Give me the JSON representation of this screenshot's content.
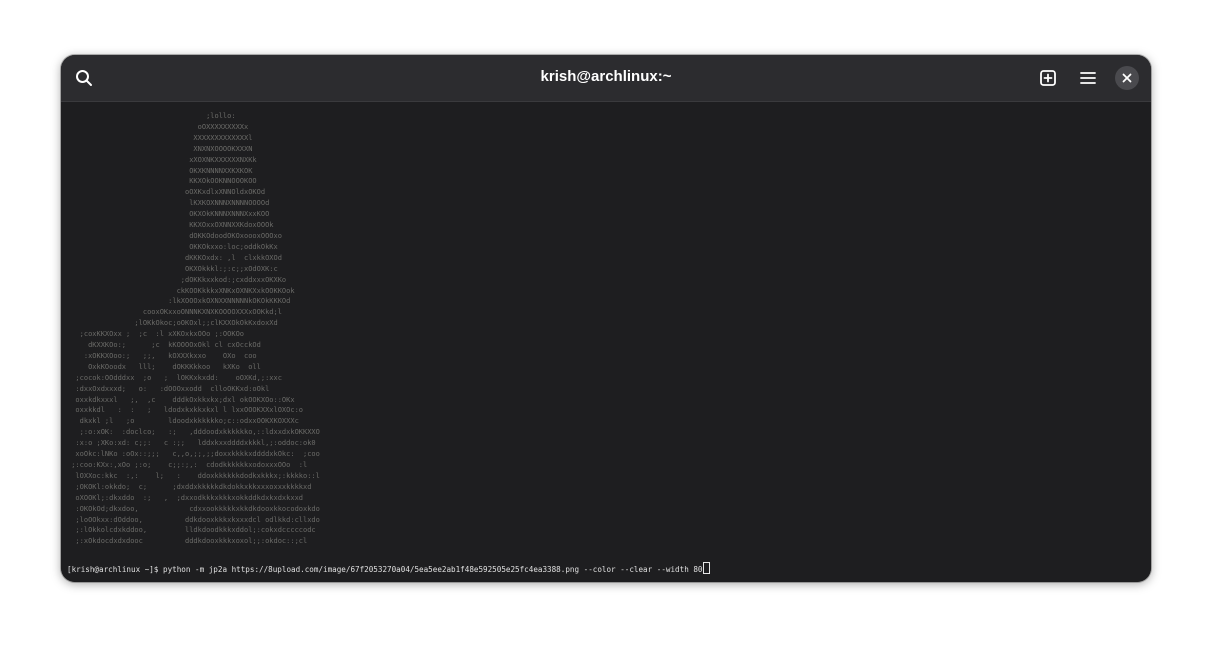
{
  "window": {
    "title": "krish@archlinux:~"
  },
  "icons": {
    "search": "search-icon",
    "new_tab": "new-tab-icon",
    "menu": "hamburger-menu-icon",
    "close": "close-icon"
  },
  "terminal": {
    "ascii_art": [
      "                                 ;lollo:",
      "                               oOXXXXXXXXXx",
      "                              XXXXXXXXXXXXXl",
      "                              XNXNXOOOOKXXXN",
      "                             xXOXNKXXXXXXNXKk",
      "                             OKXKNNNNXXKXKOK",
      "                             KKXOkOOKNNOOOKOO",
      "                            oOXKxdlxXNNOldxOKOd",
      "                             lKXKOXNNNXNNNNOOOOd",
      "                             OKXOkKNNNXNNNXxxKOO",
      "                             KKXOxxOXNNXXKdoxOOOk",
      "                             dOKKOdoodOKOxoooxOOOxo",
      "                             OKKOkxxo:loc;oddkOkKx",
      "                            dKKKOxdx: ,l  clxkkOXOd",
      "                            OKXOkkkl:;:c;;xOdOXK:c",
      "                           ;dOKKkxxkod:;cxddxxxOKXKo",
      "                          ckKOOKkkkxXNKxOXNKXxkOOKKOok",
      "                        :lkXOOOxkOXNXXNNNNNkOKOkKKKOd",
      "                  cooxOKxxoONNNKXNXKOOOOXXXxOOKkd;l",
      "                ;lOKkOkoc;oOKOxl;;clKXXOkOkKxdoxXd",
      "   ;coxKKXOxx ;  ;c  :l xXKOxkxOOo ;:OOKOo",
      "     dKXXKOo:;      ;c  kKOOOOxOkl cl cxOcckOd",
      "    :xOKKXOoo:;   ;;,   kOXXXkxxo    OXo  coo",
      "     OxkKOoodx   lll;    dOKKKkkoo   kXKo  oll",
      "  ;cocok:OOdddxx  ;o   ;  lOKKxkxdd:    oOXKd,;:xxc",
      "  :dxxOxdxxxd;   o:   :dOOOxxodd  clloOKKxd:oOkl",
      "  oxxkdkxxxl   ;,  ,c    dddkOxkkxkx;dxl okOOKXOo::OKx",
      "  oxxkkdl   :  :   ;   ldodxkxkkxkxl l lxxOOOKXXxlOXOc:o",
      "   dkxkl ;l   ;o        ldoodxkkkkkko;c::odxxOOKXKOXXXc",
      "   ;:o:xOK:  :doclco;   :;   ,dddoodxkkkkkko,::ldxxdxkOKKXXO",
      "  :x:o ;XKo:xd: c;;:   c :;;   lddxkxxddddxkkkl,;:oddoc:ok0",
      "  xoOkc:lNKo :oOx::;;;   c,,o,;;,;;doxxkkkkxddddxkOkc:  ;coo",
      " ;:coo:KXx:,xOo ;:o;    c;;:;,:  cdodkkkkkkxodoxxxOOo  :l",
      "  lOXXoc:kkc  :,:    l;   :    ddoxkkkkkkdodkxkkkx;:kkkko::l",
      "  ;OKOKl:okkdo;  c;      ;dxddxkkkkkdkdokkxkkxxxoxxxkkkkxd",
      "  oXOOKl;:dkxddo  :;   ,  ;dxxodkkkxkkkxokkddkdxkxdxkxxd",
      "  :OKOkOd;dkxdoo,            cdxxookkkkkxkkdkdooxkkocodoxkdo",
      "  ;loOOkxx:dOddoo,          ddkdooxkkkxkxxxdcl odlkkd:cllxdo",
      "  ;:lOkkolcdxkddoo,         lldkdoodkkkxddol;:cokxdcccccodc",
      "  ;:xOkdocdxdxdooc          dddkdooxkkkxoxol;;:okdoc::;cl"
    ],
    "command": "[krish@archlinux ~]$ python -m jp2a https://8upload.com/image/67f2053270a04/5ea5ee2ab1f48e592505e25fc4ea3388.png --color --clear --width 80"
  }
}
